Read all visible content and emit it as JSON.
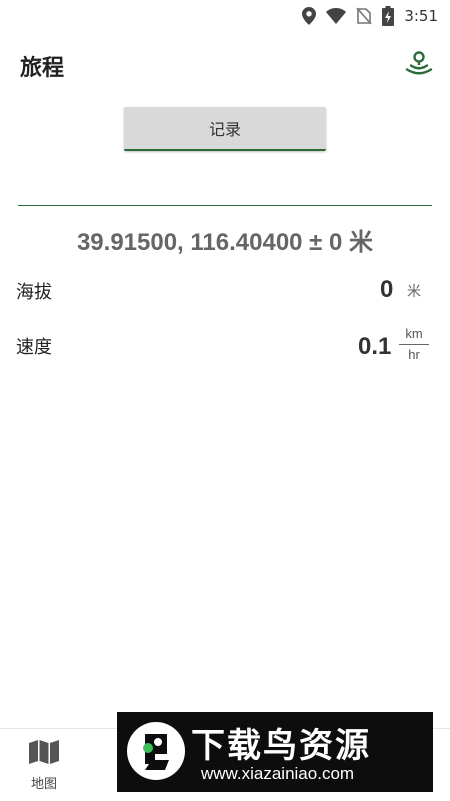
{
  "status_bar": {
    "time": "3:51",
    "icons": [
      "location-pin-icon",
      "wifi-icon",
      "no-sim-icon",
      "battery-charging-icon"
    ]
  },
  "app_bar": {
    "title": "旅程",
    "location_icon": "location-signal-icon"
  },
  "record_button": {
    "label": "记录"
  },
  "position": {
    "coords_text": "39.91500, 116.40400 ± 0 米"
  },
  "altitude": {
    "label": "海拔",
    "value": "0",
    "unit": "米"
  },
  "speed": {
    "label": "速度",
    "value": "0.1",
    "unit_numerator": "km",
    "unit_denominator": "hr"
  },
  "bottom_nav": {
    "items": [
      {
        "label": "地图",
        "icon": "map-icon"
      }
    ]
  },
  "watermark": {
    "title": "下载鸟资源",
    "url": "www.xiazainiao.com"
  },
  "colors": {
    "accent": "#2e6b3a",
    "button_bg": "#d9d9d9"
  }
}
